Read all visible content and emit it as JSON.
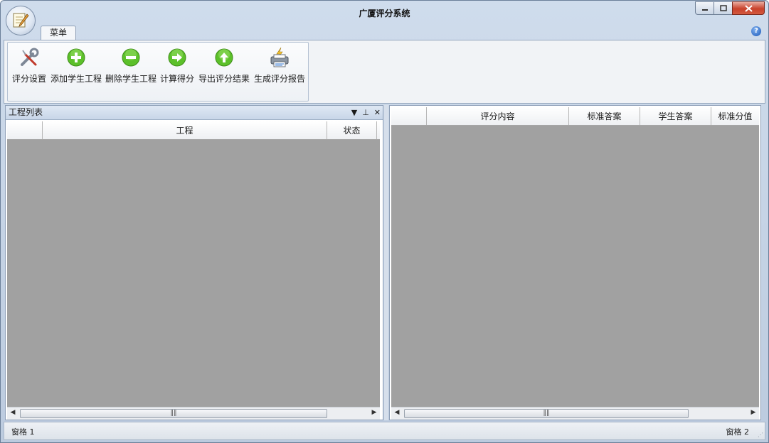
{
  "window": {
    "title": "广厦评分系统"
  },
  "ribbon": {
    "tab": "菜单",
    "tools": [
      {
        "label": "评分设置",
        "icon": "wrench-screwdriver-icon"
      },
      {
        "label": "添加学生工程",
        "icon": "plus-circle-icon"
      },
      {
        "label": "删除学生工程",
        "icon": "minus-circle-icon"
      },
      {
        "label": "计算得分",
        "icon": "arrow-right-circle-icon"
      },
      {
        "label": "导出评分结果",
        "icon": "arrow-up-circle-icon"
      },
      {
        "label": "生成评分报告",
        "icon": "printer-icon"
      }
    ]
  },
  "left_pane": {
    "title": "工程列表",
    "columns": [
      "",
      "工程",
      "状态"
    ]
  },
  "right_pane": {
    "columns": [
      "",
      "评分内容",
      "标准答案",
      "学生答案",
      "标准分值"
    ]
  },
  "statusbar": {
    "left": "窗格 1",
    "right": "窗格 2"
  },
  "colors": {
    "grid_empty": "#a1a1a1",
    "icon_green": "#5cc02a",
    "close_red": "#c8412b"
  }
}
